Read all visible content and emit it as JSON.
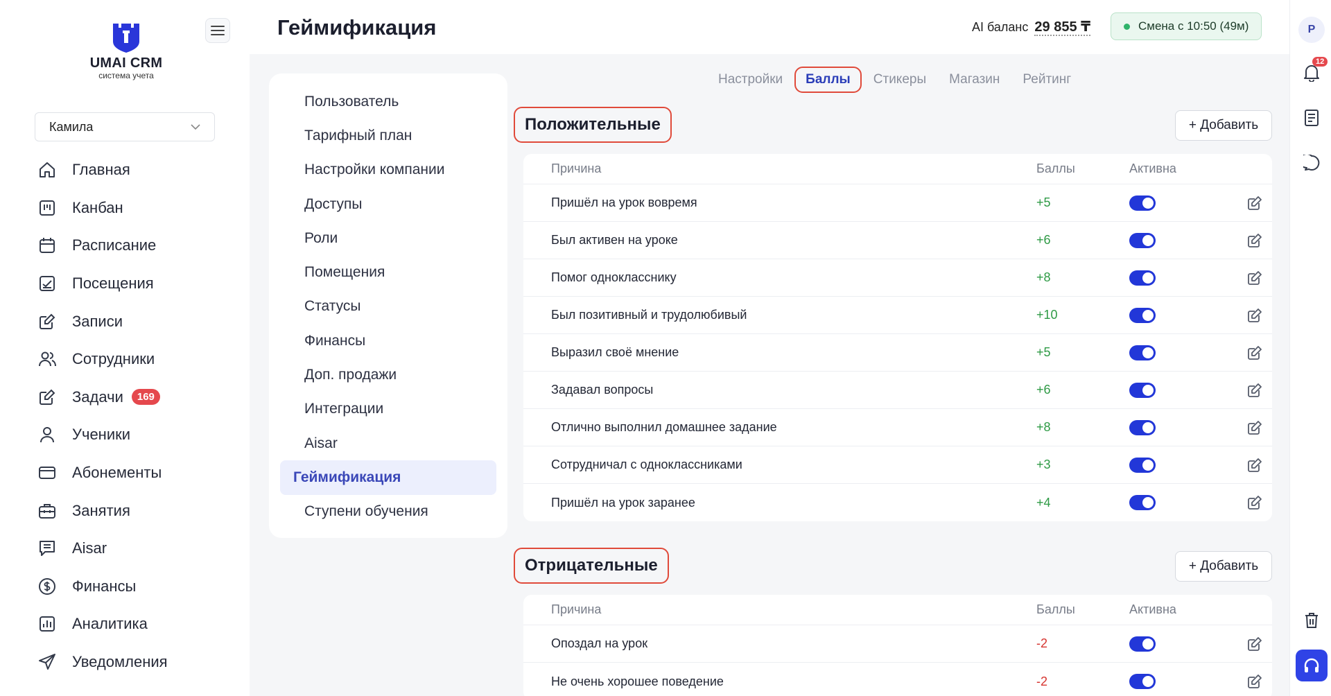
{
  "brand": {
    "title": "UMAI CRM",
    "subtitle": "система учета"
  },
  "user_select": {
    "value": "Камила"
  },
  "nav": [
    {
      "label": "Главная",
      "icon": "home-icon"
    },
    {
      "label": "Канбан",
      "icon": "kanban-icon"
    },
    {
      "label": "Расписание",
      "icon": "calendar-icon"
    },
    {
      "label": "Посещения",
      "icon": "attendance-icon"
    },
    {
      "label": "Записи",
      "icon": "edit-note-icon"
    },
    {
      "label": "Сотрудники",
      "icon": "staff-icon"
    },
    {
      "label": "Задачи",
      "icon": "tasks-icon",
      "badge": "169"
    },
    {
      "label": "Ученики",
      "icon": "student-icon"
    },
    {
      "label": "Абонементы",
      "icon": "card-icon"
    },
    {
      "label": "Занятия",
      "icon": "briefcase-icon"
    },
    {
      "label": "Aisar",
      "icon": "chat-doc-icon"
    },
    {
      "label": "Финансы",
      "icon": "dollar-icon"
    },
    {
      "label": "Аналитика",
      "icon": "chart-icon"
    },
    {
      "label": "Уведомления",
      "icon": "send-icon"
    }
  ],
  "header": {
    "title": "Геймификация",
    "ai_balance_label": "AI баланс",
    "ai_balance_value": "29 855 ₸",
    "shift": "Смена с 10:50 (49м)"
  },
  "rail": {
    "avatar": "Р",
    "notifications": "12"
  },
  "settings_menu": [
    "Пользователь",
    "Тарифный план",
    "Настройки компании",
    "Доступы",
    "Роли",
    "Помещения",
    "Статусы",
    "Финансы",
    "Доп. продажи",
    "Интеграции",
    "Aisar",
    "Геймификация",
    "Ступени обучения"
  ],
  "settings_active": "Геймификация",
  "tabs": [
    "Настройки",
    "Баллы",
    "Стикеры",
    "Магазин",
    "Рейтинг"
  ],
  "active_tab": "Баллы",
  "columns": {
    "reason": "Причина",
    "points": "Баллы",
    "active": "Активна"
  },
  "add_label": "+ Добавить",
  "positive": {
    "title": "Положительные",
    "rows": [
      {
        "reason": "Пришёл на урок вовремя",
        "points": "+5",
        "active": true
      },
      {
        "reason": "Был активен на уроке",
        "points": "+6",
        "active": true
      },
      {
        "reason": "Помог однокласснику",
        "points": "+8",
        "active": true
      },
      {
        "reason": "Был позитивный и трудолюбивый",
        "points": "+10",
        "active": true
      },
      {
        "reason": "Выразил своё мнение",
        "points": "+5",
        "active": true
      },
      {
        "reason": "Задавал вопросы",
        "points": "+6",
        "active": true
      },
      {
        "reason": "Отлично выполнил домашнее задание",
        "points": "+8",
        "active": true
      },
      {
        "reason": "Сотрудничал с одноклассниками",
        "points": "+3",
        "active": true
      },
      {
        "reason": "Пришёл на урок заранее",
        "points": "+4",
        "active": true
      }
    ]
  },
  "negative": {
    "title": "Отрицательные",
    "rows": [
      {
        "reason": "Опоздал на урок",
        "points": "-2",
        "active": true
      },
      {
        "reason": "Не очень хорошее поведение",
        "points": "-2",
        "active": true
      }
    ]
  },
  "colors": {
    "accent": "#2237d8",
    "positive": "#2e9a45",
    "negative": "#d6342f",
    "highlight": "#e04a3a"
  }
}
